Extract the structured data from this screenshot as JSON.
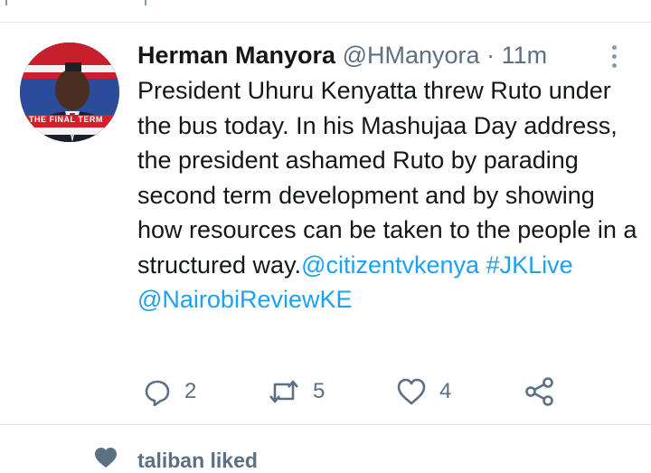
{
  "tweet": {
    "author_name": "Herman Manyora",
    "handle": "@HManyora",
    "separator": "·",
    "time": "11m",
    "text_plain": "President Uhuru Kenyatta threw Ruto under the bus today. In his Mashujaa Day address, the president ashamed Ruto by parading second term development and by showing how resources can be taken to the people in a structured way.",
    "mention_1": "@citizentvkenya",
    "hashtag": "#JKLive",
    "mention_2": "@NairobiReviewKE",
    "avatar_caption": "THE FINAL TERM"
  },
  "actions": {
    "reply_count": "2",
    "retweet_count": "5",
    "like_count": "4"
  },
  "activity": {
    "liked_text": "taliban liked"
  },
  "colors": {
    "link": "#1da1f2",
    "muted": "#5b7083",
    "text": "#14171a",
    "divider": "#e1e8ed"
  }
}
